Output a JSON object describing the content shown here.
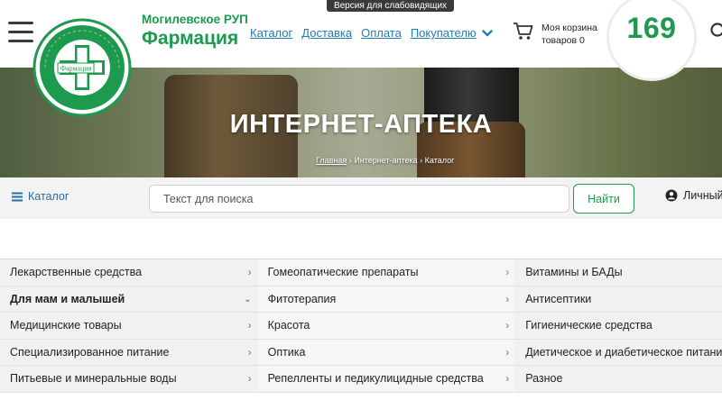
{
  "accessibility_label": "Версия для слабовидящих",
  "brand": {
    "line1": "Могилевское РУП",
    "line2": "Фармация",
    "logo_text": "Фармация"
  },
  "nav": {
    "items": [
      "Каталог",
      "Доставка",
      "Оплата",
      "Покупателю"
    ]
  },
  "cart": {
    "title": "Моя корзина",
    "count_text": "товаров 0"
  },
  "counter": "169",
  "banner": {
    "title": "ИНТЕРНЕТ-АПТЕКА",
    "breadcrumbs": [
      "Главная",
      "Интернет-аптека",
      "Каталог"
    ],
    "separator": "›"
  },
  "search": {
    "catalog_label": "Каталог",
    "placeholder": "Текст для поиска",
    "button_label": "Найти",
    "account_label": "Личный"
  },
  "categories": [
    [
      "Лекарственные средства",
      "Гомеопатические препараты",
      "Витамины и БАДы"
    ],
    [
      "Для мам и малышей",
      "Фитотерапия",
      "Антисептики"
    ],
    [
      "Медицинские товары",
      "Красота",
      "Гигиенические средства"
    ],
    [
      "Специализированное питание",
      "Оптика",
      "Диетическое и диабетическое питание"
    ],
    [
      "Питьевые и минеральные воды",
      "Репелленты и педикулицидные средства",
      "Разное"
    ]
  ],
  "colors": {
    "brand_green": "#1d9a4e",
    "link_blue": "#1f7bb0"
  }
}
